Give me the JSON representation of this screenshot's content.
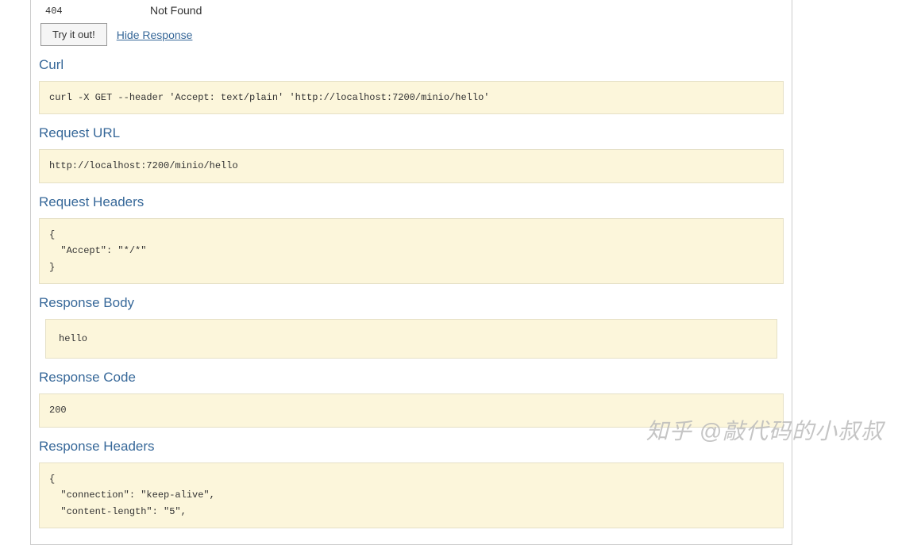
{
  "status": {
    "code": "404",
    "reason": "Not Found"
  },
  "actions": {
    "try_button": "Try it out!",
    "hide_link": "Hide Response"
  },
  "sections": {
    "curl": {
      "heading": "Curl",
      "content": "curl -X GET --header 'Accept: text/plain' 'http://localhost:7200/minio/hello'"
    },
    "request_url": {
      "heading": "Request URL",
      "content": "http://localhost:7200/minio/hello"
    },
    "request_headers": {
      "heading": "Request Headers",
      "content": "{\n  \"Accept\": \"*/*\"\n}"
    },
    "response_body": {
      "heading": "Response Body",
      "content": "hello"
    },
    "response_code": {
      "heading": "Response Code",
      "content": "200"
    },
    "response_headers": {
      "heading": "Response Headers",
      "content": "{\n  \"connection\": \"keep-alive\",\n  \"content-length\": \"5\","
    }
  },
  "watermark": "知乎 @敲代码的小叔叔"
}
